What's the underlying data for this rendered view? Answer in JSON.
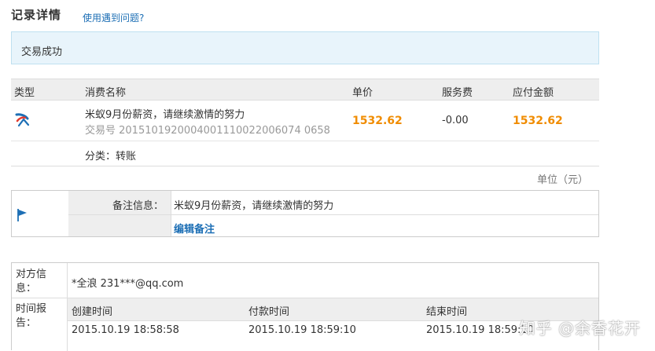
{
  "header": {
    "title": "记录详情",
    "help_link": "使用遇到问题?"
  },
  "status_banner": "交易成功",
  "table": {
    "columns": [
      "类型",
      "消费名称",
      "单价",
      "服务费",
      "应付金额"
    ],
    "row": {
      "name": "米蚁9月份薪资，请继续激情的努力",
      "trade_no": "交易号 2015101920004001110022006074 0658",
      "unit_price": "1532.62",
      "service_fee": "-0.00",
      "amount_due": "1532.62",
      "category": "分类：转账"
    }
  },
  "unit_label": "单位（元）",
  "note": {
    "label": "备注信息：",
    "value": "米蚁9月份薪资，请继续激情的努力",
    "edit_link": "编辑备注"
  },
  "counterparty": {
    "label": "对方信息：",
    "value": "*全浪 231***@qq.com"
  },
  "timeline": {
    "label": "时间报告：",
    "headers": [
      "创建时间",
      "付款时间",
      "结束时间"
    ],
    "values": [
      "2015.10.19 18:58:58",
      "2015.10.19 18:59:10",
      "2015.10.19 18:59:10"
    ]
  },
  "watermark": "知乎 @余香花开",
  "colors": {
    "accent_blue": "#1d6fb5",
    "price_orange": "#f08c00",
    "banner_bg": "#e8f4fb"
  }
}
